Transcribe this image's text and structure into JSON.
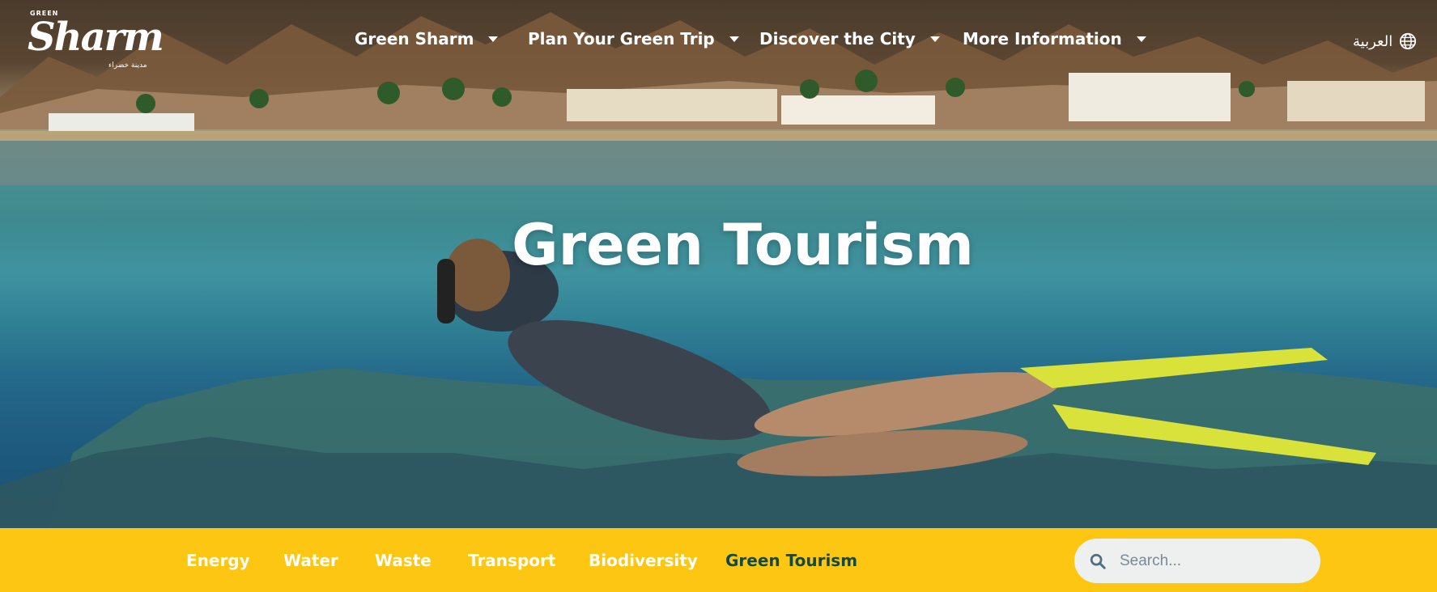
{
  "logo": {
    "small_top": "GREEN",
    "word": "Sharm",
    "subtitle": "مدينة خضراء"
  },
  "nav": {
    "items": [
      {
        "label": "Green Sharm"
      },
      {
        "label": "Plan Your Green Trip"
      },
      {
        "label": "Discover the City"
      },
      {
        "label": "More Information"
      }
    ]
  },
  "lang": {
    "label": "العربية",
    "icon": "globe-icon"
  },
  "hero": {
    "title": "Green Tourism"
  },
  "subnav": {
    "items": [
      {
        "label": "Energy"
      },
      {
        "label": "Water"
      },
      {
        "label": "Waste"
      },
      {
        "label": "Transport"
      },
      {
        "label": "Biodiversity"
      },
      {
        "label": "Green Tourism",
        "active": true
      }
    ]
  },
  "search": {
    "placeholder": "Search...",
    "icon": "search-icon"
  },
  "colors": {
    "subnav_bg": "#fcc613",
    "active_tab": "#0f4a45"
  }
}
